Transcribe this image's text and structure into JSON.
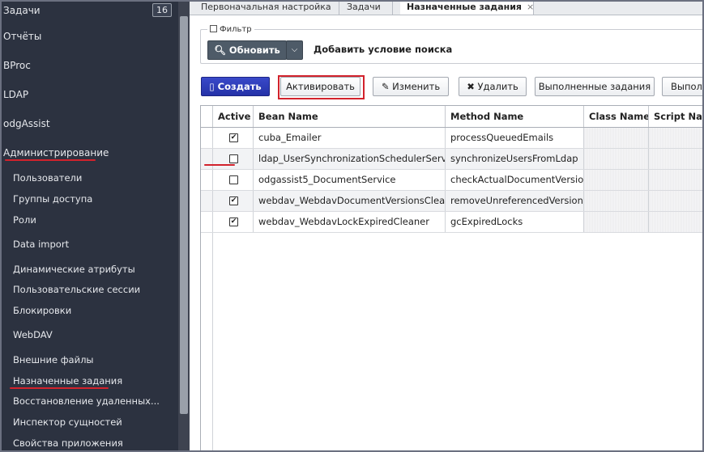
{
  "sidebar": {
    "tasks_label": "Задачи",
    "tasks_count": "16",
    "items_top": [
      "Отчёты",
      "BProc",
      "LDAP",
      "odgAssist",
      "Администрирование"
    ],
    "items_sub": [
      "Пользователи",
      "Группы доступа",
      "Роли",
      "Data import",
      "Динамические атрибуты",
      "Пользовательские сессии",
      "Блокировки",
      "WebDAV",
      "Внешние файлы",
      "Назначенные задания",
      "Восстановление удаленных...",
      "Инспектор сущностей",
      "Свойства приложения"
    ]
  },
  "tabs": [
    {
      "label": "Первоначальная настройка"
    },
    {
      "label": "Задачи"
    },
    {
      "label": "Назначенные задания",
      "close": "×"
    }
  ],
  "filter": {
    "legend": "Фильтр",
    "refresh_label": "Обновить",
    "dropdown_glyph": "⌵",
    "add_condition": "Добавить условие поиска"
  },
  "toolbar": {
    "create": "Создать",
    "activate": "Активировать",
    "edit": "Изменить",
    "delete": "Удалить",
    "done": "Выполненные задания",
    "more": "Выпол"
  },
  "table": {
    "headers": [
      "Active",
      "Bean Name",
      "Method Name",
      "Class Name",
      "Script Name"
    ],
    "rows": [
      {
        "active": "✔",
        "bean": "cuba_Emailer",
        "method": "processQueuedEmails"
      },
      {
        "active": "",
        "bean": "ldap_UserSynchronizationSchedulerService",
        "method": "synchronizeUsersFromLdap"
      },
      {
        "active": "",
        "bean": "odgassist5_DocumentService",
        "method": "checkActualDocumentVersions"
      },
      {
        "active": "✔",
        "bean": "webdav_WebdavDocumentVersionsCleaner",
        "method": "removeUnreferencedVersions"
      },
      {
        "active": "✔",
        "bean": "webdav_WebdavLockExpiredCleaner",
        "method": "gcExpiredLocks"
      }
    ]
  },
  "colors": {
    "accent": "#d2222c",
    "sidebar_bg": "#2c3240",
    "create_btn": "#2f3db8"
  }
}
